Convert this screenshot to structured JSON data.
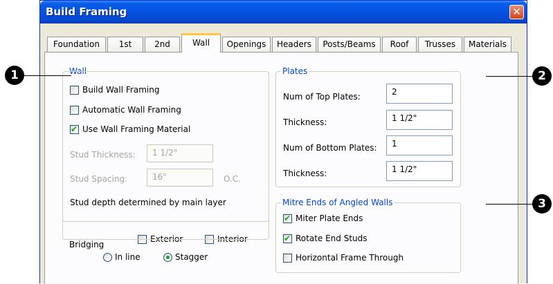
{
  "window": {
    "title": "Build Framing",
    "close_glyph": "✕"
  },
  "tabs": [
    {
      "label": "Foundation"
    },
    {
      "label": "1st"
    },
    {
      "label": "2nd"
    },
    {
      "label": "Wall",
      "active": true
    },
    {
      "label": "Openings"
    },
    {
      "label": "Headers"
    },
    {
      "label": "Posts/Beams"
    },
    {
      "label": "Roof"
    },
    {
      "label": "Trusses"
    },
    {
      "label": "Materials"
    }
  ],
  "wall": {
    "legend": "Wall",
    "build_wall_framing": {
      "label": "Build Wall Framing",
      "checked": false
    },
    "automatic_wall_framing": {
      "label": "Automatic Wall Framing",
      "checked": false
    },
    "use_wall_framing_material": {
      "label": "Use Wall Framing Material",
      "checked": true
    },
    "stud_thickness": {
      "label": "Stud Thickness:",
      "value": "1 1/2\""
    },
    "stud_spacing": {
      "label": "Stud Spacing:",
      "value": "16\"",
      "suffix": "O.C."
    },
    "note": "Stud depth determined by main layer",
    "bridging": {
      "label": "Bridging",
      "exterior": {
        "label": "Exterior",
        "checked": false
      },
      "interior": {
        "label": "Interior",
        "checked": false
      },
      "in_line": {
        "label": "In line",
        "selected": false
      },
      "stagger": {
        "label": "Stagger",
        "selected": true
      }
    }
  },
  "plates": {
    "legend": "Plates",
    "num_top": {
      "label": "Num of Top Plates:",
      "value": "2"
    },
    "top_thickness": {
      "label": "Thickness:",
      "value": "1 1/2\""
    },
    "num_bottom": {
      "label": "Num of Bottom Plates:",
      "value": "1"
    },
    "bottom_thickness": {
      "label": "Thickness:",
      "value": "1 1/2\""
    }
  },
  "mitre": {
    "legend": "Mitre Ends of Angled Walls",
    "miter_plate_ends": {
      "label": "Miter Plate Ends",
      "checked": true
    },
    "rotate_end_studs": {
      "label": "Rotate End Studs",
      "checked": true
    },
    "horizontal_frame_through": {
      "label": "Horizontal Frame Through",
      "checked": false
    }
  },
  "callouts": [
    "1",
    "2",
    "3"
  ],
  "check_glyph": "✔",
  "colors": {
    "title_bar": "#0553e1",
    "legend_text": "#0046d5",
    "tab_highlight": "#ffc83c",
    "check": "#21a121",
    "close_button": "#d2471f"
  }
}
